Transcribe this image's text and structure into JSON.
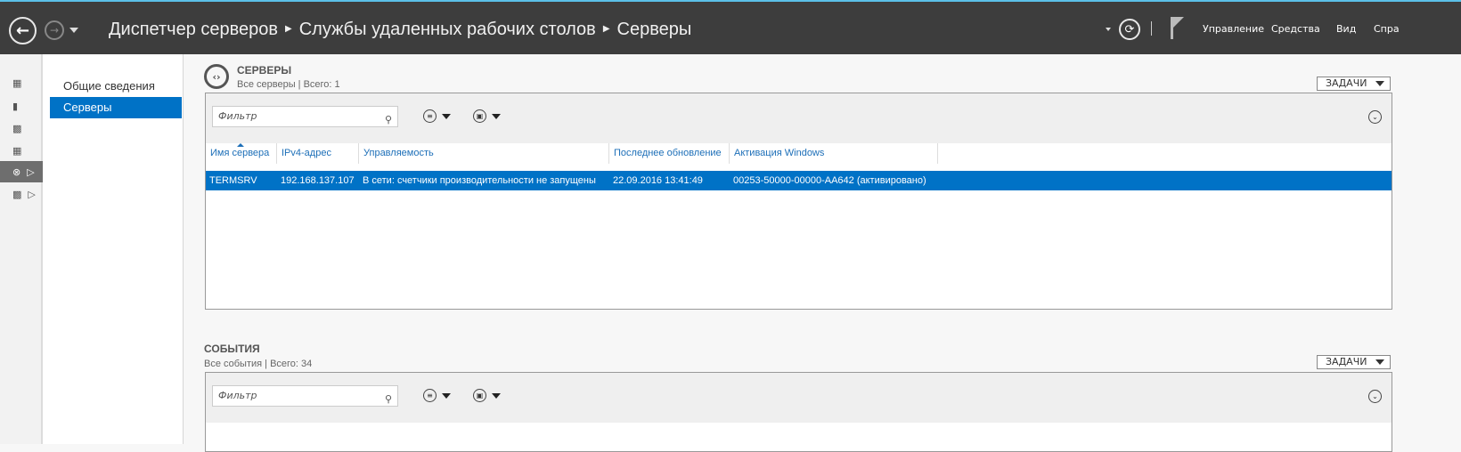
{
  "titlebar": {
    "breadcrumb": [
      "Диспетчер серверов",
      "Службы удаленных рабочих столов",
      "Серверы"
    ],
    "menu": [
      "Управление",
      "Средства",
      "Вид",
      "Спра"
    ]
  },
  "nav": {
    "items": [
      {
        "label": "Общие сведения"
      },
      {
        "label": "Серверы"
      }
    ]
  },
  "servers": {
    "title": "СЕРВЕРЫ",
    "subtitle": "Все серверы | Всего: 1",
    "tasks": "ЗАДАЧИ",
    "filter_placeholder": "Фильтр",
    "columns": [
      "Имя сервера",
      "IPv4-адрес",
      "Управляемость",
      "Последнее обновление",
      "Активация Windows"
    ],
    "rows": [
      {
        "name": "TERMSRV",
        "ip": "192.168.137.107",
        "manage": "В сети: счетчики производительности не запущены",
        "updated": "22.09.2016 13:41:49",
        "activation": "00253-50000-00000-AA642 (активировано)"
      }
    ]
  },
  "events": {
    "title": "СОБЫТИЯ",
    "subtitle": "Все события | Всего: 34",
    "tasks": "ЗАДАЧИ",
    "filter_placeholder": "Фильтр"
  },
  "colors": {
    "accent": "#0072c6",
    "titlebar": "#3d3d3d"
  }
}
